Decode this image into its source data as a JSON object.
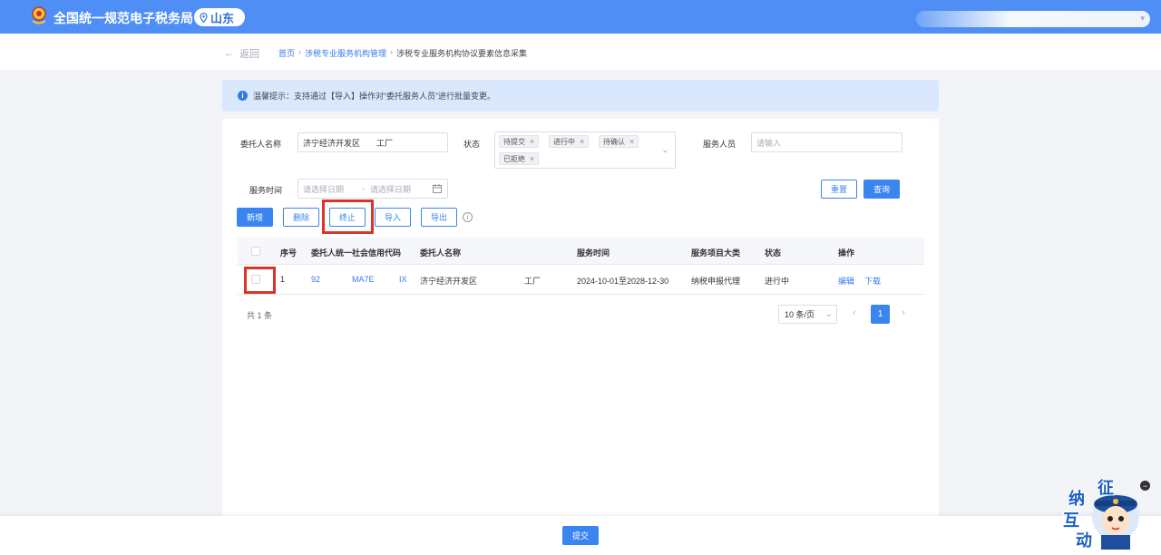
{
  "header": {
    "site_title": "全国统一规范电子税务局",
    "region": "山东",
    "icons": {
      "logo": "tax-emblem-icon",
      "location": "location-pin-icon"
    }
  },
  "breadcrumb": {
    "back_label": "返回",
    "items": [
      "首页",
      "涉税专业服务机构管理",
      "涉税专业服务机构协议要素信息采集"
    ]
  },
  "tip": {
    "text": "温馨提示：支持通过【导入】操作对“委托服务人员”进行批量变更。"
  },
  "filters": {
    "client_name_label": "委托人名称",
    "client_name_value": "济宁经济开发区",
    "client_name_suffix": "工厂",
    "status_label": "状态",
    "status_tags": [
      "待提交",
      "进行中",
      "待确认",
      "已拒绝"
    ],
    "service_person_label": "服务人员",
    "service_person_placeholder": "请输入",
    "service_time_label": "服务时间",
    "date_start_placeholder": "请选择日期",
    "date_sep": "-",
    "date_end_placeholder": "请选择日期",
    "reset_label": "重置",
    "query_label": "查询"
  },
  "toolbar": {
    "add_label": "新增",
    "delete_label": "删除",
    "terminate_label": "终止",
    "import_label": "导入",
    "export_label": "导出"
  },
  "table": {
    "headers": [
      "序号",
      "委托人统一社会信用代码",
      "委托人名称",
      "服务时间",
      "服务项目大类",
      "状态",
      "操作"
    ],
    "rows": [
      {
        "index": "1",
        "code_parts": [
          "92",
          "MA7E",
          "IX"
        ],
        "name": "济宁经济开发区",
        "name_suffix": "工厂",
        "service_time": "2024-10-01至2028-12-30",
        "category": "纳税申报代理",
        "status": "进行中",
        "actions": [
          "编辑",
          "下载"
        ]
      }
    ]
  },
  "pagination": {
    "total_label": "共 1 条",
    "page_size": "10 条/页",
    "current_page": "1"
  },
  "footer": {
    "submit_label": "提交"
  },
  "mascot": {
    "chars": [
      "征",
      "纳",
      "互",
      "动"
    ],
    "close": "−"
  },
  "colors": {
    "header_bg": "#4e8ef5",
    "primary": "#3a85f0",
    "highlight": "#d9362b",
    "tip_bg": "#d9e8fd"
  }
}
